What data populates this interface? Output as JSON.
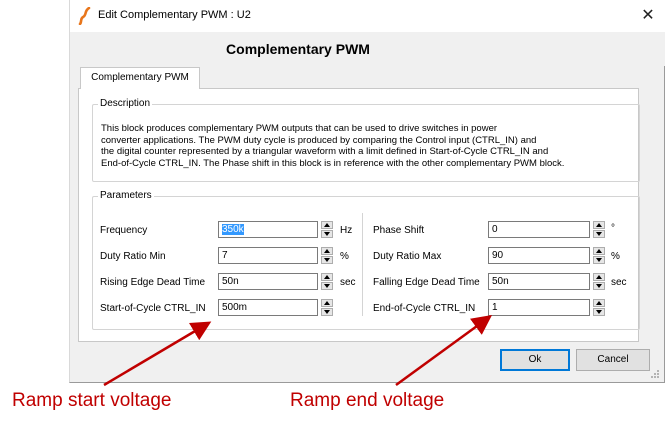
{
  "window": {
    "title": "Edit Complementary PWM : U2",
    "close_glyph": "✕"
  },
  "header": {
    "title": "Complementary PWM"
  },
  "tab": {
    "label": "Complementary PWM"
  },
  "description": {
    "label": "Description",
    "lines": [
      "This block produces complementary PWM outputs that can be used to drive switches in power",
      "converter applications. The PWM duty cycle is produced by comparing the Control input (CTRL_IN) and",
      "the digital counter represented by a triangular waveform with a limit defined in Start-of-Cycle CTRL_IN and",
      "End-of-Cycle CTRL_IN. The Phase shift in this block is in reference with the other complementary PWM block."
    ]
  },
  "parameters": {
    "label": "Parameters",
    "left": [
      {
        "label": "Frequency",
        "value": "350k",
        "unit": "Hz"
      },
      {
        "label": "Duty Ratio Min",
        "value": "7",
        "unit": "%"
      },
      {
        "label": "Rising Edge Dead Time",
        "value": "50n",
        "unit": "sec"
      },
      {
        "label": "Start-of-Cycle CTRL_IN",
        "value": "500m",
        "unit": ""
      }
    ],
    "right": [
      {
        "label": "Phase Shift",
        "value": "0",
        "unit": "°"
      },
      {
        "label": "Duty Ratio Max",
        "value": "90",
        "unit": "%"
      },
      {
        "label": "Falling Edge Dead Time",
        "value": "50n",
        "unit": "sec"
      },
      {
        "label": "End-of-Cycle CTRL_IN",
        "value": "1",
        "unit": ""
      }
    ]
  },
  "buttons": {
    "ok": "Ok",
    "cancel": "Cancel"
  },
  "annotations": {
    "ramp_start": "Ramp start voltage",
    "ramp_end": "Ramp end voltage",
    "color": "#c00000"
  },
  "icons": {
    "title_logo": "app-logo-icon",
    "close": "close-icon",
    "spin": "spin-button-icon"
  }
}
